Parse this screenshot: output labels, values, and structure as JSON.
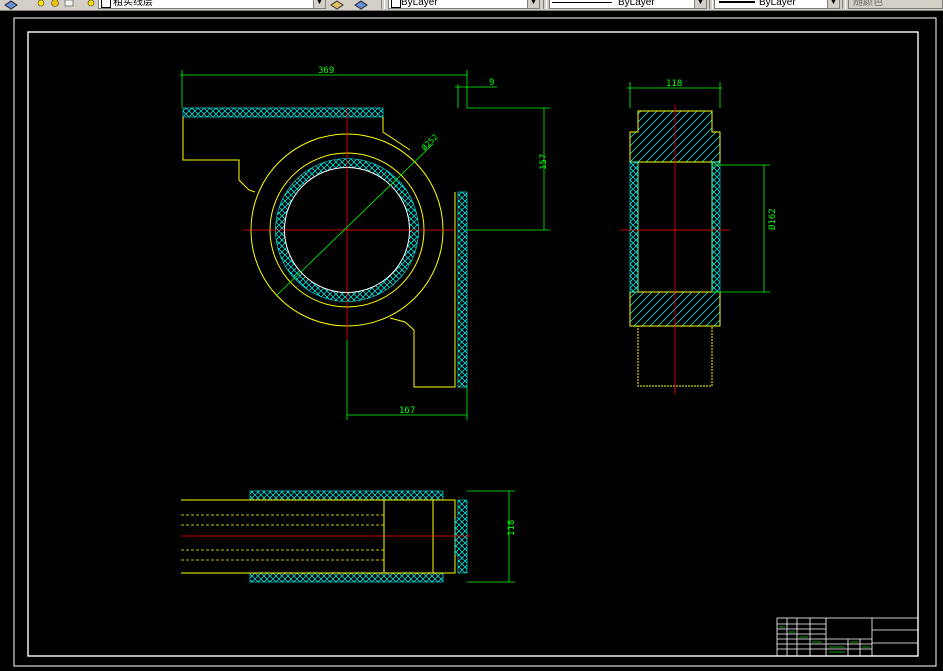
{
  "toolbar": {
    "layer_name": "粗实线层",
    "color_value": "ByLayer",
    "linetype_value": "ByLayer",
    "lineweight_value": "ByLayer",
    "plotstyle_value": "随颜色"
  },
  "colors": {
    "background": "#000000",
    "outline": "#ffffff",
    "part": "#ffff00",
    "hatch": "#00ffff",
    "dimension": "#00ff00",
    "centerline": "#ff0000"
  },
  "drawing": {
    "dimensions": {
      "top_width": "369",
      "gap": "9",
      "height_right": "157",
      "diameter_bore": "Ø252",
      "base_width": "167",
      "side_width": "118",
      "side_diameter": "Ø162",
      "bottom_width": "118"
    }
  }
}
